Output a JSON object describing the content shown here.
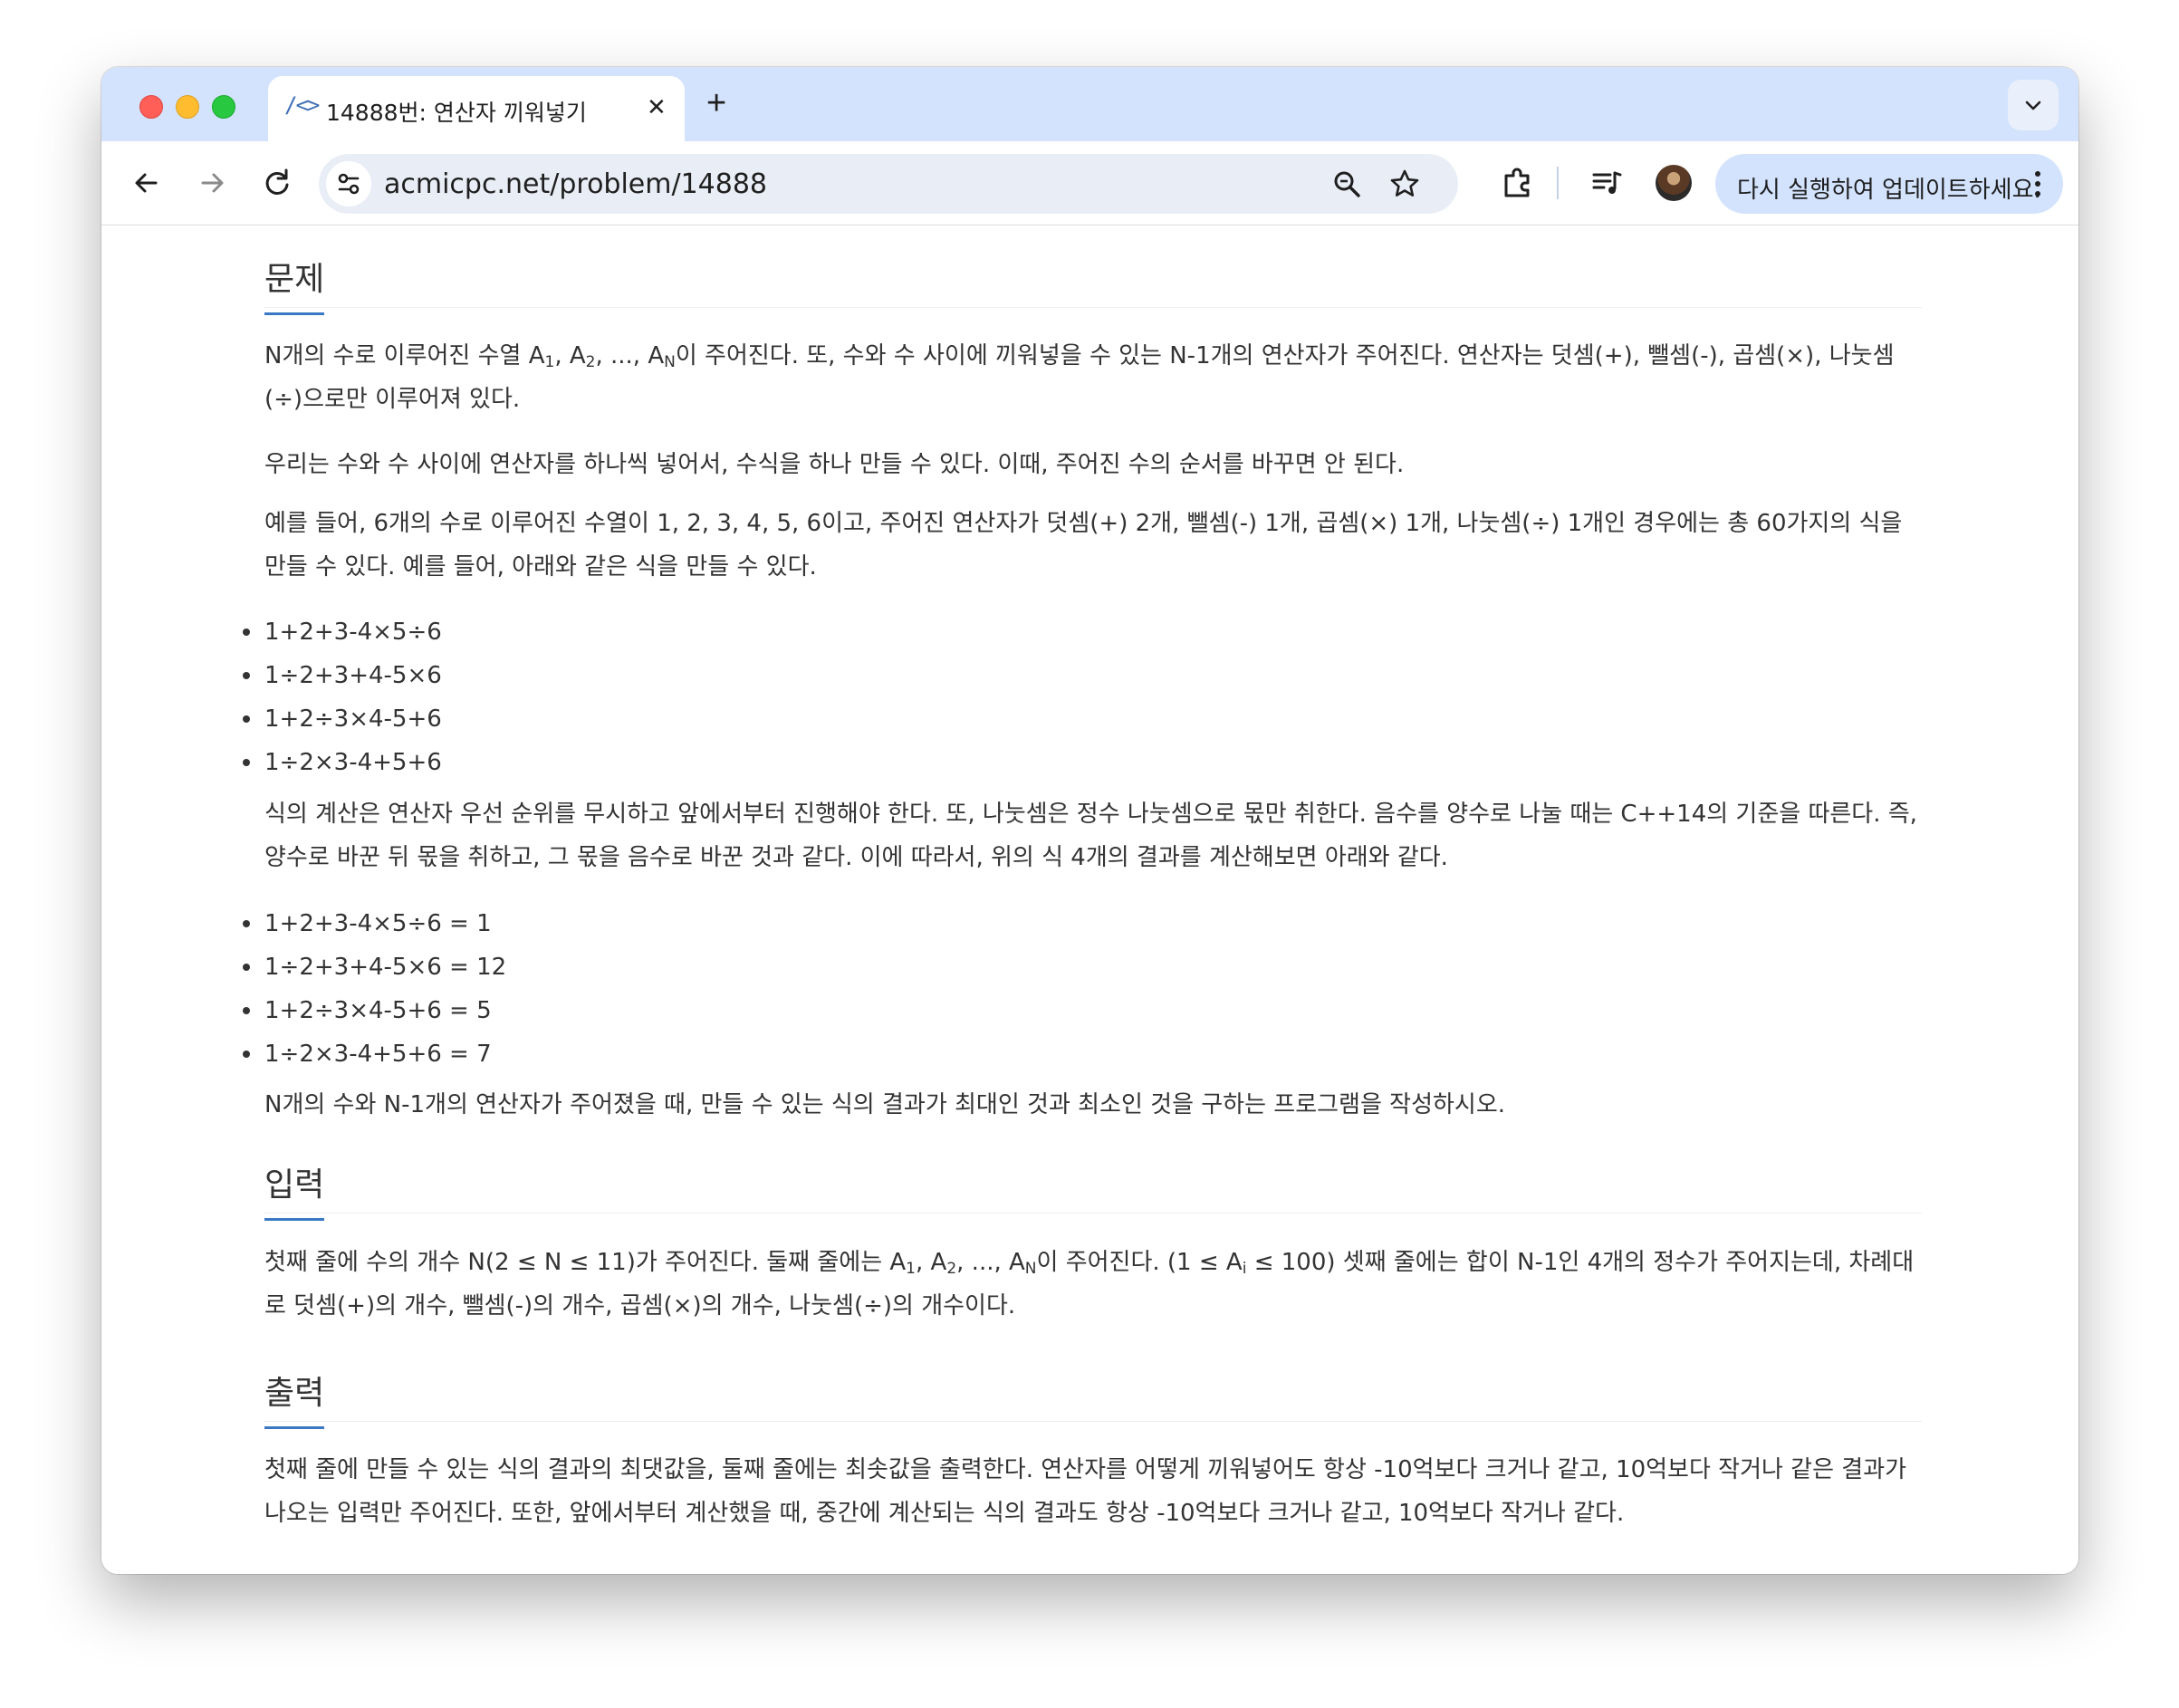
{
  "browser": {
    "tab_favicon": "/<>",
    "tab_title": "14888번: 연산자 끼워넣기",
    "tab_close": "✕",
    "new_tab": "+",
    "url": "acmicpc.net/problem/14888",
    "update_button_label": "다시 실행하여 업데이트하세요."
  },
  "problem": {
    "section_title": "문제",
    "p1_part1": "N개의 수로 이루어진 수열 A",
    "p1_sub1": "1",
    "p1_part2": ", A",
    "p1_sub2": "2",
    "p1_part3": ", ..., A",
    "p1_sub3": "N",
    "p1_part4": "이 주어진다. 또, 수와 수 사이에 끼워넣을 수 있는 N-1개의 연산자가 주어진다. 연산자는 덧셈(+), 뺄셈(-), 곱셈(×), 나눗셈(÷)으로만 이루어져 있다.",
    "p2": "우리는 수와 수 사이에 연산자를 하나씩 넣어서, 수식을 하나 만들 수 있다. 이때, 주어진 수의 순서를 바꾸면 안 된다.",
    "p3": "예를 들어, 6개의 수로 이루어진 수열이 1, 2, 3, 4, 5, 6이고, 주어진 연산자가 덧셈(+) 2개, 뺄셈(-) 1개, 곱셈(×) 1개, 나눗셈(÷) 1개인 경우에는 총 60가지의 식을 만들 수 있다. 예를 들어, 아래와 같은 식을 만들 수 있다.",
    "examples": [
      "1+2+3-4×5÷6",
      "1÷2+3+4-5×6",
      "1+2÷3×4-5+6",
      "1÷2×3-4+5+6"
    ],
    "p4": "식의 계산은 연산자 우선 순위를 무시하고 앞에서부터 진행해야 한다. 또, 나눗셈은 정수 나눗셈으로 몫만 취한다. 음수를 양수로 나눌 때는 C++14의 기준을 따른다. 즉, 양수로 바꾼 뒤 몫을 취하고, 그 몫을 음수로 바꾼 것과 같다. 이에 따라서, 위의 식 4개의 결과를 계산해보면 아래와 같다.",
    "results": [
      "1+2+3-4×5÷6 = 1",
      "1÷2+3+4-5×6 = 12",
      "1+2÷3×4-5+6 = 5",
      "1÷2×3-4+5+6 = 7"
    ],
    "p5": "N개의 수와 N-1개의 연산자가 주어졌을 때, 만들 수 있는 식의 결과가 최대인 것과 최소인 것을 구하는 프로그램을 작성하시오."
  },
  "input": {
    "section_title": "입력",
    "part1": "첫째 줄에 수의 개수 N(2 ≤ N ≤ 11)가 주어진다. 둘째 줄에는 A",
    "sub1": "1",
    "part2": ", A",
    "sub2": "2",
    "part3": ", ..., A",
    "sub3": "N",
    "part4": "이 주어진다. (1 ≤ A",
    "sub4": "i",
    "part5": " ≤ 100) 셋째 줄에는 합이 N-1인 4개의 정수가 주어지는데, 차례대로 덧셈(+)의 개수, 뺄셈(-)의 개수, 곱셈(×)의 개수, 나눗셈(÷)의 개수이다."
  },
  "output": {
    "section_title": "출력",
    "text": "첫째 줄에 만들 수 있는 식의 결과의 최댓값을, 둘째 줄에는 최솟값을 출력한다. 연산자를 어떻게 끼워넣어도 항상 -10억보다 크거나 같고, 10억보다 작거나 같은 결과가 나오는 입력만 주어진다. 또한, 앞에서부터 계산했을 때, 중간에 계산되는 식의 결과도 항상 -10억보다 크거나 같고, 10억보다 작거나 같다."
  }
}
